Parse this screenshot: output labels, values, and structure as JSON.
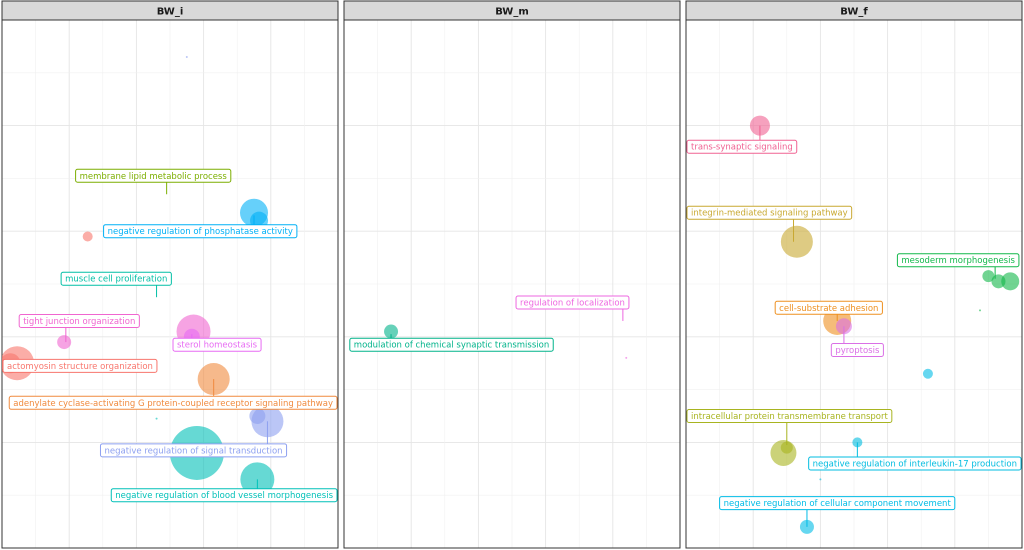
{
  "chart_data": {
    "type": "scatter",
    "facets": [
      "BW_i",
      "BW_m",
      "BW_f"
    ],
    "xlim": [
      0,
      10
    ],
    "ylim": [
      0,
      10
    ],
    "grid": true,
    "colors": {
      "actomyosin structure organization": "#F8766D",
      "adenylate cyclase-activating G protein-coupled receptor signaling pathway": "#F08A3E",
      "membrane lipid metabolic process": "#7CAE00",
      "muscle cell proliferation": "#00BFA5",
      "negative regulation of phosphatase activity": "#00B0F6",
      "negative regulation of signal transduction": "#8DA0F0",
      "negative regulation of blood vessel morphogenesis": "#00C0B8",
      "tight junction organization": "#F066D0",
      "sterol homeostasis": "#E76BF3",
      "regulation of localization": "#EE67E0",
      "modulation of chemical synaptic transmission": "#00B38A",
      "trans-synaptic signaling": "#F06292",
      "integrin-mediated signaling pathway": "#C8A830",
      "mesoderm morphogenesis": "#12B84A",
      "cell-substrate adhesion": "#EE9020",
      "pyroptosis": "#DA6FE6",
      "intracellular protein transmembrane transport": "#A8B420",
      "negative regulation of interleukin-17 production": "#00BCE0",
      "negative regulation of cellular component movement": "#00BCE6",
      "other": "#9EC8EE"
    },
    "points": [
      {
        "facet": "BW_i",
        "x": 5.5,
        "y": 9.3,
        "size": 1,
        "group": "negative regulation of signal transduction"
      },
      {
        "facet": "BW_i",
        "x": 2.55,
        "y": 5.9,
        "size": 5,
        "group": "actomyosin structure organization"
      },
      {
        "facet": "BW_i",
        "x": 7.5,
        "y": 6.35,
        "size": 14,
        "group": "negative regulation of phosphatase activity"
      },
      {
        "facet": "BW_i",
        "x": 7.65,
        "y": 6.2,
        "size": 9,
        "group": "negative regulation of phosphatase activity"
      },
      {
        "facet": "BW_i",
        "x": 5.7,
        "y": 4.1,
        "size": 17,
        "group": "tight junction organization"
      },
      {
        "facet": "BW_i",
        "x": 5.65,
        "y": 4.0,
        "size": 8,
        "group": "sterol homeostasis"
      },
      {
        "facet": "BW_i",
        "x": 1.85,
        "y": 3.9,
        "size": 7,
        "group": "tight junction organization"
      },
      {
        "facet": "BW_i",
        "x": 0.45,
        "y": 3.5,
        "size": 17,
        "group": "actomyosin structure organization"
      },
      {
        "facet": "BW_i",
        "x": 0.25,
        "y": 3.5,
        "size": 10,
        "group": "actomyosin structure organization"
      },
      {
        "facet": "BW_i",
        "x": 6.3,
        "y": 3.2,
        "size": 16,
        "group": "adenylate cyclase-activating G protein-coupled receptor signaling pathway"
      },
      {
        "facet": "BW_i",
        "x": 7.9,
        "y": 2.4,
        "size": 16,
        "group": "negative regulation of signal transduction"
      },
      {
        "facet": "BW_i",
        "x": 7.6,
        "y": 2.5,
        "size": 8,
        "group": "negative regulation of signal transduction"
      },
      {
        "facet": "BW_i",
        "x": 5.8,
        "y": 1.8,
        "size": 27,
        "group": "negative regulation of blood vessel morphogenesis"
      },
      {
        "facet": "BW_i",
        "x": 7.6,
        "y": 1.3,
        "size": 17,
        "group": "negative regulation of blood vessel morphogenesis"
      },
      {
        "facet": "BW_i",
        "x": 4.6,
        "y": 2.45,
        "size": 1,
        "group": "negative regulation of blood vessel morphogenesis"
      },
      {
        "facet": "BW_m",
        "x": 1.4,
        "y": 4.1,
        "size": 7,
        "group": "modulation of chemical synaptic transmission"
      },
      {
        "facet": "BW_m",
        "x": 8.4,
        "y": 3.6,
        "size": 1,
        "group": "regulation of localization"
      },
      {
        "facet": "BW_f",
        "x": 2.2,
        "y": 8.0,
        "size": 10,
        "group": "trans-synaptic signaling"
      },
      {
        "facet": "BW_f",
        "x": 3.3,
        "y": 5.8,
        "size": 16,
        "group": "integrin-mediated signaling pathway"
      },
      {
        "facet": "BW_f",
        "x": 9.0,
        "y": 5.15,
        "size": 6,
        "group": "mesoderm morphogenesis"
      },
      {
        "facet": "BW_f",
        "x": 9.3,
        "y": 5.05,
        "size": 7,
        "group": "mesoderm morphogenesis"
      },
      {
        "facet": "BW_f",
        "x": 9.65,
        "y": 5.05,
        "size": 9,
        "group": "mesoderm morphogenesis"
      },
      {
        "facet": "BW_f",
        "x": 8.75,
        "y": 4.5,
        "size": 1,
        "group": "mesoderm morphogenesis"
      },
      {
        "facet": "BW_f",
        "x": 4.5,
        "y": 4.3,
        "size": 14,
        "group": "cell-substrate adhesion"
      },
      {
        "facet": "BW_f",
        "x": 4.7,
        "y": 4.2,
        "size": 8,
        "group": "pyroptosis"
      },
      {
        "facet": "BW_f",
        "x": 7.2,
        "y": 3.3,
        "size": 5,
        "group": "negative regulation of cellular component movement"
      },
      {
        "facet": "BW_f",
        "x": 2.9,
        "y": 1.8,
        "size": 13,
        "group": "intracellular protein transmembrane transport"
      },
      {
        "facet": "BW_f",
        "x": 3.0,
        "y": 1.9,
        "size": 6,
        "group": "intracellular protein transmembrane transport"
      },
      {
        "facet": "BW_f",
        "x": 5.1,
        "y": 2.0,
        "size": 5,
        "group": "negative regulation of interleukin-17 production"
      },
      {
        "facet": "BW_f",
        "x": 4.0,
        "y": 1.3,
        "size": 1,
        "group": "negative regulation of interleukin-17 production"
      },
      {
        "facet": "BW_f",
        "x": 3.6,
        "y": 0.4,
        "size": 7,
        "group": "negative regulation of cellular component movement"
      }
    ],
    "labels": [
      {
        "facet": "BW_i",
        "text": "membrane lipid metabolic process",
        "x": 4.5,
        "y": 7.05,
        "px": 4.9,
        "py": 6.7
      },
      {
        "facet": "BW_i",
        "text": "negative regulation of phosphatase activity",
        "x": 5.9,
        "y": 6.0,
        "px": 7.5,
        "py": 6.3
      },
      {
        "facet": "BW_i",
        "text": "muscle cell proliferation",
        "x": 3.4,
        "y": 5.1,
        "px": 4.6,
        "py": 4.75
      },
      {
        "facet": "BW_i",
        "text": "tight junction organization",
        "x": 2.3,
        "y": 4.3,
        "px": 1.9,
        "py": 3.9
      },
      {
        "facet": "BW_i",
        "text": "sterol homeostasis",
        "x": 6.4,
        "y": 3.85,
        "px": 5.65,
        "py": 4.05
      },
      {
        "facet": "BW_i",
        "text": "actomyosin structure organization",
        "x": 2.2,
        "y": 3.45,
        "px": 0.5,
        "py": 3.5
      },
      {
        "facet": "BW_i",
        "text": "adenylate cyclase-activating G protein-coupled receptor signaling pathway",
        "x": 5.2,
        "y": 2.75,
        "px": 6.3,
        "py": 3.2
      },
      {
        "facet": "BW_i",
        "text": "negative regulation of signal transduction",
        "x": 5.7,
        "y": 1.85,
        "px": 7.9,
        "py": 2.4
      },
      {
        "facet": "BW_i",
        "text": "negative regulation of blood vessel morphogenesis",
        "x": 6.9,
        "y": 1.0,
        "px": 7.6,
        "py": 1.3
      },
      {
        "facet": "BW_m",
        "text": "regulation of localization",
        "x": 6.8,
        "y": 4.65,
        "px": 8.3,
        "py": 4.3
      },
      {
        "facet": "BW_m",
        "text": "modulation of chemical synaptic transmission",
        "x": 3.2,
        "y": 3.85,
        "px": 1.4,
        "py": 4.05
      },
      {
        "facet": "BW_f",
        "text": "trans-synaptic signaling",
        "x": 1.6,
        "y": 7.6,
        "px": 2.2,
        "py": 8.0
      },
      {
        "facet": "BW_f",
        "text": "integrin-mediated signaling pathway",
        "x": 2.4,
        "y": 6.35,
        "px": 3.2,
        "py": 5.8
      },
      {
        "facet": "BW_f",
        "text": "mesoderm morphogenesis",
        "x": 8.1,
        "y": 5.45,
        "px": 9.2,
        "py": 5.1
      },
      {
        "facet": "BW_f",
        "text": "cell-substrate adhesion",
        "x": 4.25,
        "y": 4.55,
        "px": 4.5,
        "py": 4.3
      },
      {
        "facet": "BW_f",
        "text": "pyroptosis",
        "x": 5.1,
        "y": 3.75,
        "px": 4.7,
        "py": 4.2
      },
      {
        "facet": "BW_f",
        "text": "intracellular protein transmembrane transport",
        "x": 2.8,
        "y": 2.5,
        "px": 3.0,
        "py": 1.95
      },
      {
        "facet": "BW_f",
        "text": "negative regulation of interleukin-17 production",
        "x": 7.2,
        "y": 1.6,
        "px": 5.1,
        "py": 2.0
      },
      {
        "facet": "BW_f",
        "text": "negative regulation of cellular component movement",
        "x": 4.5,
        "y": 0.85,
        "px": 3.6,
        "py": 0.4
      }
    ]
  }
}
